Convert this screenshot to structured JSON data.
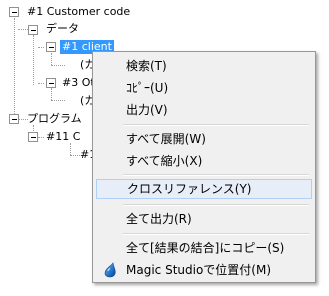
{
  "tree": {
    "root": "#1 Customer code",
    "data_folder": "データ",
    "client_node": "#1 client",
    "child_1": "(カ",
    "other_node": "#3 Ot",
    "child_2": "(カ",
    "program_folder": "プログラム",
    "program_node": "#11 C",
    "program_child": "#1"
  },
  "context_menu": {
    "items": [
      "検索(T)",
      "ｺﾋﾟｰ(U)",
      "出力(V)",
      "すべて展開(W)",
      "すべて縮小(X)",
      "クロスリファレンス(Y)",
      "全て出力(R)",
      "全て[結果の結合]にコピー(S)",
      "Magic Studioで位置付(M)"
    ],
    "hovered_item": "クロスリファレンス(Y)",
    "magic_icon": "magic-drop-icon"
  }
}
